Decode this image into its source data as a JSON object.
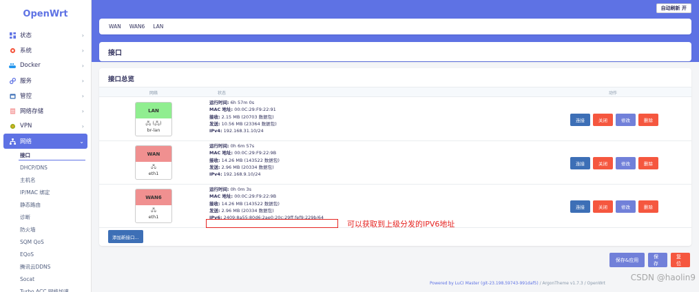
{
  "app": {
    "logo": "OpenWrt",
    "refresh_label": "自动刷新 开"
  },
  "sidebar": {
    "items": [
      {
        "label": "状态",
        "icon": "dashboard-icon",
        "color": "#5e72e4"
      },
      {
        "label": "系统",
        "icon": "gear-icon",
        "color": "#f5573f"
      },
      {
        "label": "Docker",
        "icon": "docker-icon",
        "color": "#2496ed"
      },
      {
        "label": "服务",
        "icon": "link-icon",
        "color": "#5e72e4"
      },
      {
        "label": "管控",
        "icon": "calendar-icon",
        "color": "#3d6fb6"
      },
      {
        "label": "网络存储",
        "icon": "storage-icon",
        "color": "#f5a3a3"
      },
      {
        "label": "VPN",
        "icon": "vpn-icon",
        "color": "#a0b020"
      },
      {
        "label": "网络",
        "icon": "network-icon",
        "color": "#ffffff"
      }
    ],
    "submenu": [
      "接口",
      "DHCP/DNS",
      "主机名",
      "IP/MAC 绑定",
      "静态路由",
      "诊断",
      "防火墙",
      "SQM QoS",
      "EQoS",
      "腾讯云DDNS",
      "Socat",
      "Turbo ACC 网络加速"
    ]
  },
  "tabs": [
    "WAN",
    "WAN6",
    "LAN"
  ],
  "page_title": "接口",
  "panel_title": "接口总览",
  "table_headers": {
    "network": "网络",
    "status": "状态",
    "actions": "动作"
  },
  "interfaces": [
    {
      "name": "LAN",
      "color": "#90ee90",
      "device": "br-lan",
      "icon_text": "🖧 (🖧)",
      "lines": [
        {
          "k": "运行时间:",
          "v": " 6h 57m 0s"
        },
        {
          "k": "MAC 地址:",
          "v": " 00:0C:29:F9:22:91"
        },
        {
          "k": "接收:",
          "v": " 2.15 MB (20703 数据包)"
        },
        {
          "k": "发送:",
          "v": " 10.56 MB (23364 数据包)"
        },
        {
          "k": "IPv4:",
          "v": " 192.168.31.10/24"
        }
      ]
    },
    {
      "name": "WAN",
      "color": "#f09090",
      "device": "eth1",
      "icon_text": "🖧",
      "lines": [
        {
          "k": "运行时间:",
          "v": " 0h 6m 57s"
        },
        {
          "k": "MAC 地址:",
          "v": " 00:0C:29:F9:22:9B"
        },
        {
          "k": "接收:",
          "v": " 14.26 MB (143522 数据包)"
        },
        {
          "k": "发送:",
          "v": " 2.96 MB (20334 数据包)"
        },
        {
          "k": "IPv4:",
          "v": " 192.168.9.10/24"
        }
      ]
    },
    {
      "name": "WAN6",
      "color": "#f09090",
      "device": "eth1",
      "icon_text": "🖧",
      "lines": [
        {
          "k": "运行时间:",
          "v": " 0h 0m 3s"
        },
        {
          "k": "MAC 地址:",
          "v": " 00:0C:29:F9:22:9B"
        },
        {
          "k": "接收:",
          "v": " 14.26 MB (143522 数据包)"
        },
        {
          "k": "发送:",
          "v": " 2.96 MB (20334 数据包)"
        },
        {
          "k": "IPv6:",
          "v": " 2409:8a55:80d6:2ae0:20c:29ff:fef9:229b/64"
        }
      ]
    }
  ],
  "row_buttons": {
    "connect": "连接",
    "close": "关闭",
    "edit": "修改",
    "delete": "删除"
  },
  "add_button": "添加新接口...",
  "annotation": "可以获取到上级分发的IPV6地址",
  "bottom_buttons": {
    "save_apply": "保存&应用",
    "save": "保存",
    "reset": "复位"
  },
  "footer": {
    "link": "Powered by LuCI Master (git-23.198.59743-991daf5)",
    "rest": " / ArgonTheme v1.7.3 / OpenWrt"
  },
  "watermark": "CSDN @haolin9"
}
